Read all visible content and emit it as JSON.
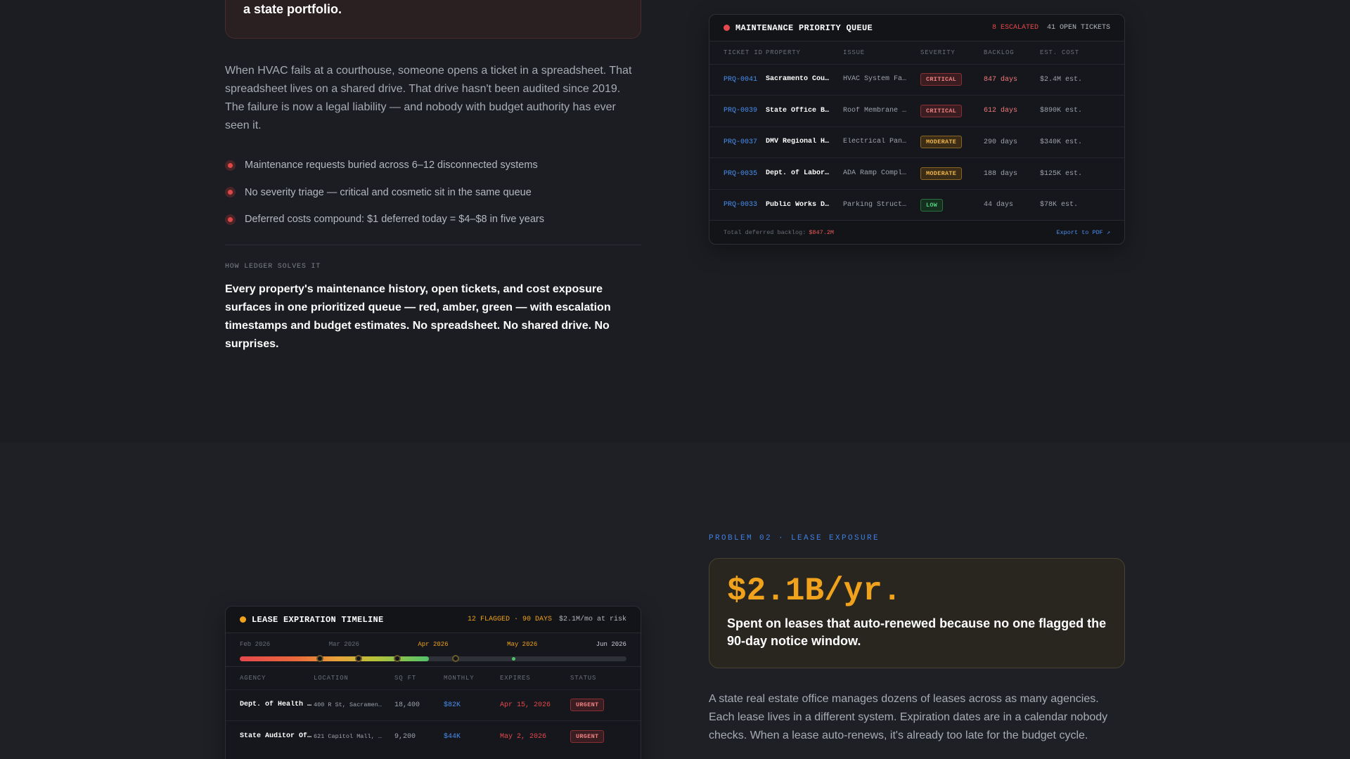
{
  "problem_01": {
    "card_desc": "a state portfolio.",
    "body": "When HVAC fails at a courthouse, someone opens a ticket in a spreadsheet. That spreadsheet lives on a shared drive. That drive hasn't been audited since 2019. The failure is now a legal liability — and nobody with budget authority has ever seen it.",
    "bullets": [
      "Maintenance requests buried across 6–12 disconnected systems",
      "No severity triage — critical and cosmetic sit in the same queue",
      "Deferred costs compound: $1 deferred today = $4–$8 in five years"
    ],
    "solve_label": "HOW LEDGER SOLVES IT",
    "solve_text": "Every property's maintenance history, open tickets, and cost exposure surfaces in one prioritized queue — red, amber, green — with escalation timestamps and budget estimates. No spreadsheet. No shared drive. No surprises."
  },
  "maintenance_queue": {
    "title": "MAINTENANCE PRIORITY QUEUE",
    "escalated": "8 ESCALATED",
    "open_tickets": "41 OPEN TICKETS",
    "columns": [
      "TICKET ID",
      "PROPERTY",
      "ISSUE",
      "SEVERITY",
      "BACKLOG",
      "EST. COST"
    ],
    "rows": [
      {
        "id": "PRQ-0041",
        "property": "Sacramento Cou…",
        "issue": "HVAC System Fa…",
        "severity": "CRITICAL",
        "backlog": "847 days",
        "cost": "$2.4M est."
      },
      {
        "id": "PRQ-0039",
        "property": "State Office B…",
        "issue": "Roof Membrane …",
        "severity": "CRITICAL",
        "backlog": "612 days",
        "cost": "$890K est."
      },
      {
        "id": "PRQ-0037",
        "property": "DMV Regional H…",
        "issue": "Electrical Pan…",
        "severity": "MODERATE",
        "backlog": "290 days",
        "cost": "$340K est."
      },
      {
        "id": "PRQ-0035",
        "property": "Dept. of Labor…",
        "issue": "ADA Ramp Compl…",
        "severity": "MODERATE",
        "backlog": "188 days",
        "cost": "$125K est."
      },
      {
        "id": "PRQ-0033",
        "property": "Public Works D…",
        "issue": "Parking Struct…",
        "severity": "LOW",
        "backlog": "44 days",
        "cost": "$78K est."
      }
    ],
    "footer_label": "Total deferred backlog:",
    "footer_amount": "$847.2M",
    "export_label": "Export to PDF ↗",
    "colors": {
      "critical": "#e5484d",
      "moderate": "#f0a21c",
      "low": "#52c26a",
      "link": "#4a8ff0"
    }
  },
  "problem_02": {
    "label": "PROBLEM 02 · LEASE EXPOSURE",
    "big_stat": "$2.1B/yr.",
    "card_desc": "Spent on leases that auto-renewed because no one flagged the 90-day notice window.",
    "body": "A state real estate office manages dozens of leases across as many agencies. Each lease lives in a different system. Expiration dates are in a calendar nobody checks. When a lease auto-renews, it's already too late for the budget cycle."
  },
  "lease_timeline": {
    "title": "LEASE EXPIRATION TIMELINE",
    "flagged": "12 FLAGGED · 90 DAYS",
    "at_risk": "$2.1M/mo at risk",
    "months": [
      "Feb 2026",
      "Mar 2026",
      "Apr 2026",
      "May 2026",
      "Jun 2026"
    ],
    "columns": [
      "AGENCY",
      "LOCATION",
      "SQ FT",
      "MONTHLY",
      "EXPIRES",
      "STATUS"
    ],
    "rows": [
      {
        "agency": "Dept. of Health …",
        "location": "400 R St, Sacramen…",
        "sqft": "18,400",
        "monthly": "$82K",
        "expires": "Apr 15, 2026",
        "status": "URGENT"
      },
      {
        "agency": "State Auditor Of…",
        "location": "621 Capitol Mall, …",
        "sqft": "9,200",
        "monthly": "$44K",
        "expires": "May 2, 2026",
        "status": "URGENT"
      }
    ]
  }
}
